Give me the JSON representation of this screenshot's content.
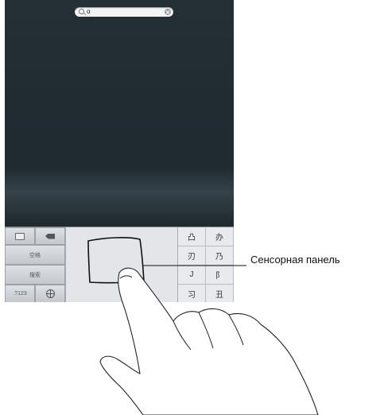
{
  "search": {
    "query": "α",
    "icon": "search-icon",
    "clear_icon": "clear-icon"
  },
  "keyboard": {
    "hide_key_icon": "keyboard-hide-icon",
    "delete_key_icon": "delete-icon",
    "space_label": "空格",
    "search_label": "搜索",
    "numbers_label": ".?123",
    "globe_icon": "globe-icon",
    "candidates": [
      "凸",
      "办",
      "刃",
      "乃",
      "J",
      "阝",
      "习",
      "丑"
    ]
  },
  "callout": {
    "label": "Сенсорная панель"
  },
  "colors": {
    "screen_background": "#243036",
    "keyboard_background": "#c6c9cd",
    "touchpad_background": "#e3e5e8"
  }
}
